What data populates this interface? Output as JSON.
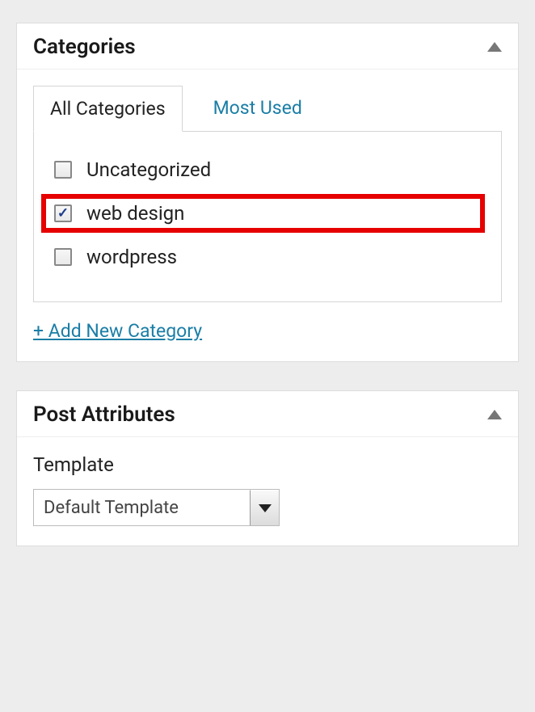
{
  "categories_panel": {
    "title": "Categories",
    "tabs": {
      "all": "All Categories",
      "most_used": "Most Used"
    },
    "items": [
      {
        "label": "Uncategorized",
        "checked": false,
        "highlighted": false
      },
      {
        "label": "web design",
        "checked": true,
        "highlighted": true
      },
      {
        "label": "wordpress",
        "checked": false,
        "highlighted": false
      }
    ],
    "add_new_label": "+ Add New Category"
  },
  "post_attributes_panel": {
    "title": "Post Attributes",
    "template_label": "Template",
    "template_value": "Default Template"
  }
}
